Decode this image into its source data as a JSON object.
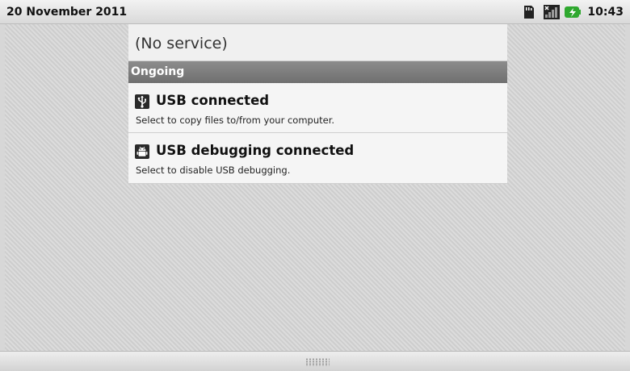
{
  "status_bar": {
    "date": "20 November 2011",
    "time": "10:43",
    "icons": [
      "sd-card-icon",
      "signal-no-service-icon",
      "battery-charging-icon"
    ]
  },
  "panel": {
    "carrier": "(No service)",
    "section_header": "Ongoing",
    "notifications": [
      {
        "icon": "usb-icon",
        "title": "USB connected",
        "text": "Select to copy files to/from your computer."
      },
      {
        "icon": "android-debug-icon",
        "title": "USB debugging connected",
        "text": "Select to disable USB debugging."
      }
    ]
  },
  "colors": {
    "header_bg": "#7d7d7d",
    "battery_green": "#2fa82f"
  }
}
